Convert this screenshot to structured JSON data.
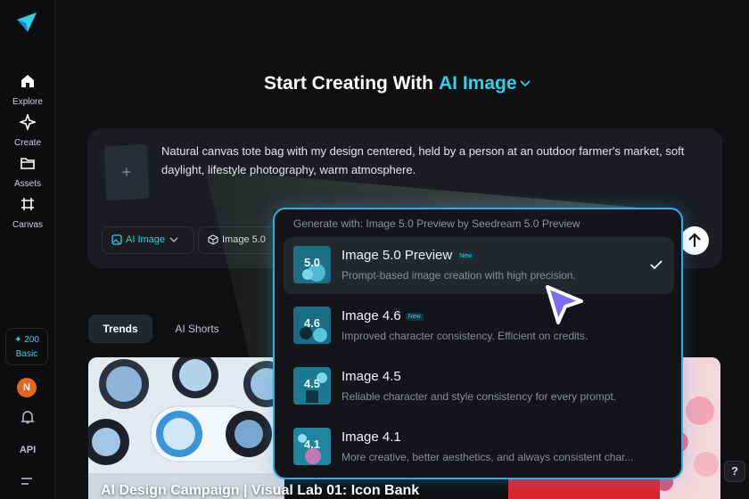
{
  "sidebar": {
    "items": [
      {
        "label": "Explore",
        "icon": "home-icon"
      },
      {
        "label": "Create",
        "icon": "sparkle-icon"
      },
      {
        "label": "Assets",
        "icon": "folder-icon"
      },
      {
        "label": "Canvas",
        "icon": "canvas-icon"
      }
    ],
    "credits_amount": "✦ 200",
    "plan": "Basic",
    "avatar_initial": "N",
    "api_label": "API"
  },
  "header": {
    "title_prefix": "Start Creating With",
    "title_accent": "AI Image"
  },
  "prompt": {
    "text": "Natural canvas tote bag with my design centered, held by a person at an outdoor farmer's market, soft daylight, lifestyle photography, warm atmosphere.",
    "upload_plus": "+",
    "mode_chip": "AI Image",
    "model_chip": "Image 5.0"
  },
  "tabs": [
    {
      "label": "Trends",
      "active": true
    },
    {
      "label": "AI Shorts",
      "active": false
    }
  ],
  "gallery": {
    "caption": "AI Design Campaign | Visual Lab 01: Icon Bank"
  },
  "dropdown": {
    "header": "Generate with: Image 5.0 Preview by Seedream 5.0 Preview",
    "options": [
      {
        "name": "Image 5.0 Preview",
        "badge": "New",
        "desc": "Prompt-based image creation with high precision.",
        "thumb": "5.0",
        "selected": true
      },
      {
        "name": "Image 4.6",
        "badge": "New",
        "desc": "Improved character consistency. Efficient on credits.",
        "thumb": "4.6",
        "selected": false
      },
      {
        "name": "Image 4.5",
        "badge": "",
        "desc": "Reliable character and style consistency for every prompt.",
        "thumb": "4.5",
        "selected": false
      },
      {
        "name": "Image 4.1",
        "badge": "",
        "desc": "More creative, better aesthetics, and always consistent char...",
        "thumb": "4.1",
        "selected": false
      }
    ]
  },
  "help_label": "?",
  "colors": {
    "accent": "#2fd1e6",
    "dropdown_border": "#3aa8e6",
    "cursor": "#7b6cf5"
  }
}
